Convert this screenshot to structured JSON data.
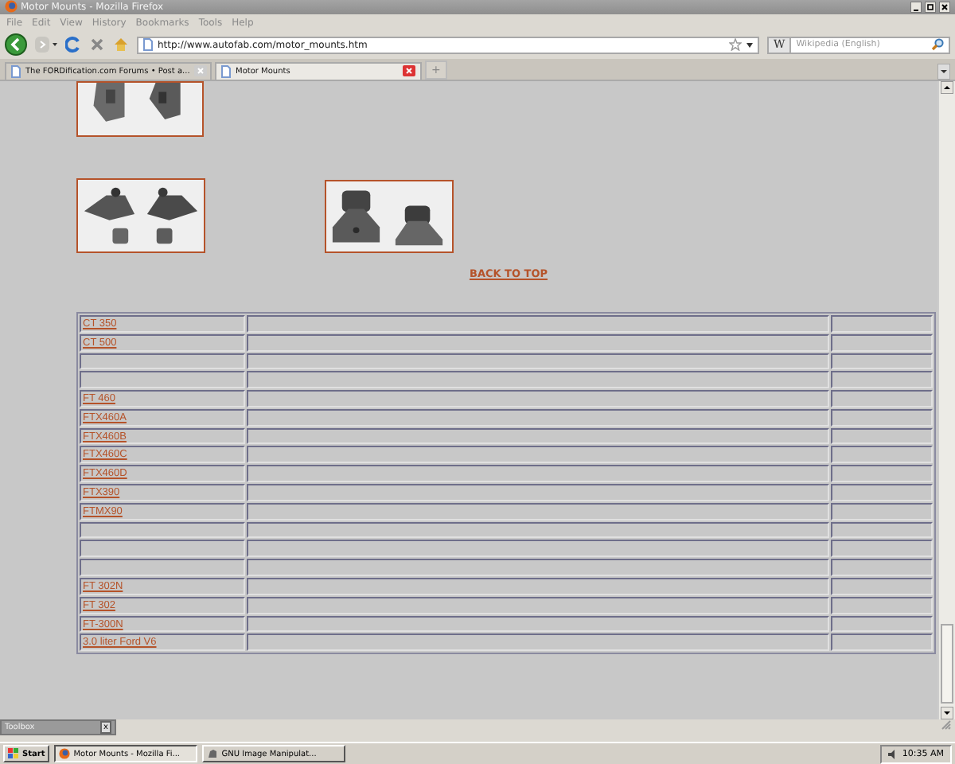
{
  "window": {
    "title": "Motor Mounts - Mozilla Firefox"
  },
  "menu": [
    "File",
    "Edit",
    "View",
    "History",
    "Bookmarks",
    "Tools",
    "Help"
  ],
  "address_bar": {
    "value": "http://www.autofab.com/motor_mounts.htm"
  },
  "search": {
    "engine": "W",
    "placeholder": "Wikipedia (English)"
  },
  "tabs": [
    {
      "label": "The FORDification.com Forums • Post a...",
      "selected": false
    },
    {
      "label": "Motor Mounts",
      "selected": true
    }
  ],
  "new_tab": "+",
  "page": {
    "back_to_top": "BACK TO TOP",
    "rows": [
      {
        "kind": "link",
        "model": "CT 350"
      },
      {
        "kind": "link",
        "model": "CT 500"
      },
      {
        "kind": "blank"
      },
      {
        "kind": "blank"
      },
      {
        "kind": "link",
        "model": "FT 460"
      },
      {
        "kind": "link",
        "model": "FTX460A"
      },
      {
        "kind": "link",
        "model": "FTX460B"
      },
      {
        "kind": "link",
        "model": "FTX460C"
      },
      {
        "kind": "link",
        "model": "FTX460D"
      },
      {
        "kind": "link",
        "model": "FTX390"
      },
      {
        "kind": "link",
        "model": "FTMX90"
      },
      {
        "kind": "blank"
      },
      {
        "kind": "blank"
      },
      {
        "kind": "blank"
      },
      {
        "kind": "link",
        "model": "FT 302N"
      },
      {
        "kind": "link",
        "model": "FT 302"
      },
      {
        "kind": "link",
        "model": "FT-300N"
      },
      {
        "kind": "link",
        "model": "3.0 liter Ford V6"
      }
    ]
  },
  "toolbox": {
    "title": "Toolbox",
    "close": "x"
  },
  "taskbar": {
    "start": "Start",
    "tasks": [
      {
        "label": "Motor Mounts - Mozilla Fi...",
        "selected": true
      },
      {
        "label": "GNU Image Manipulat...",
        "selected": false
      }
    ],
    "clock": "10:35 AM"
  }
}
